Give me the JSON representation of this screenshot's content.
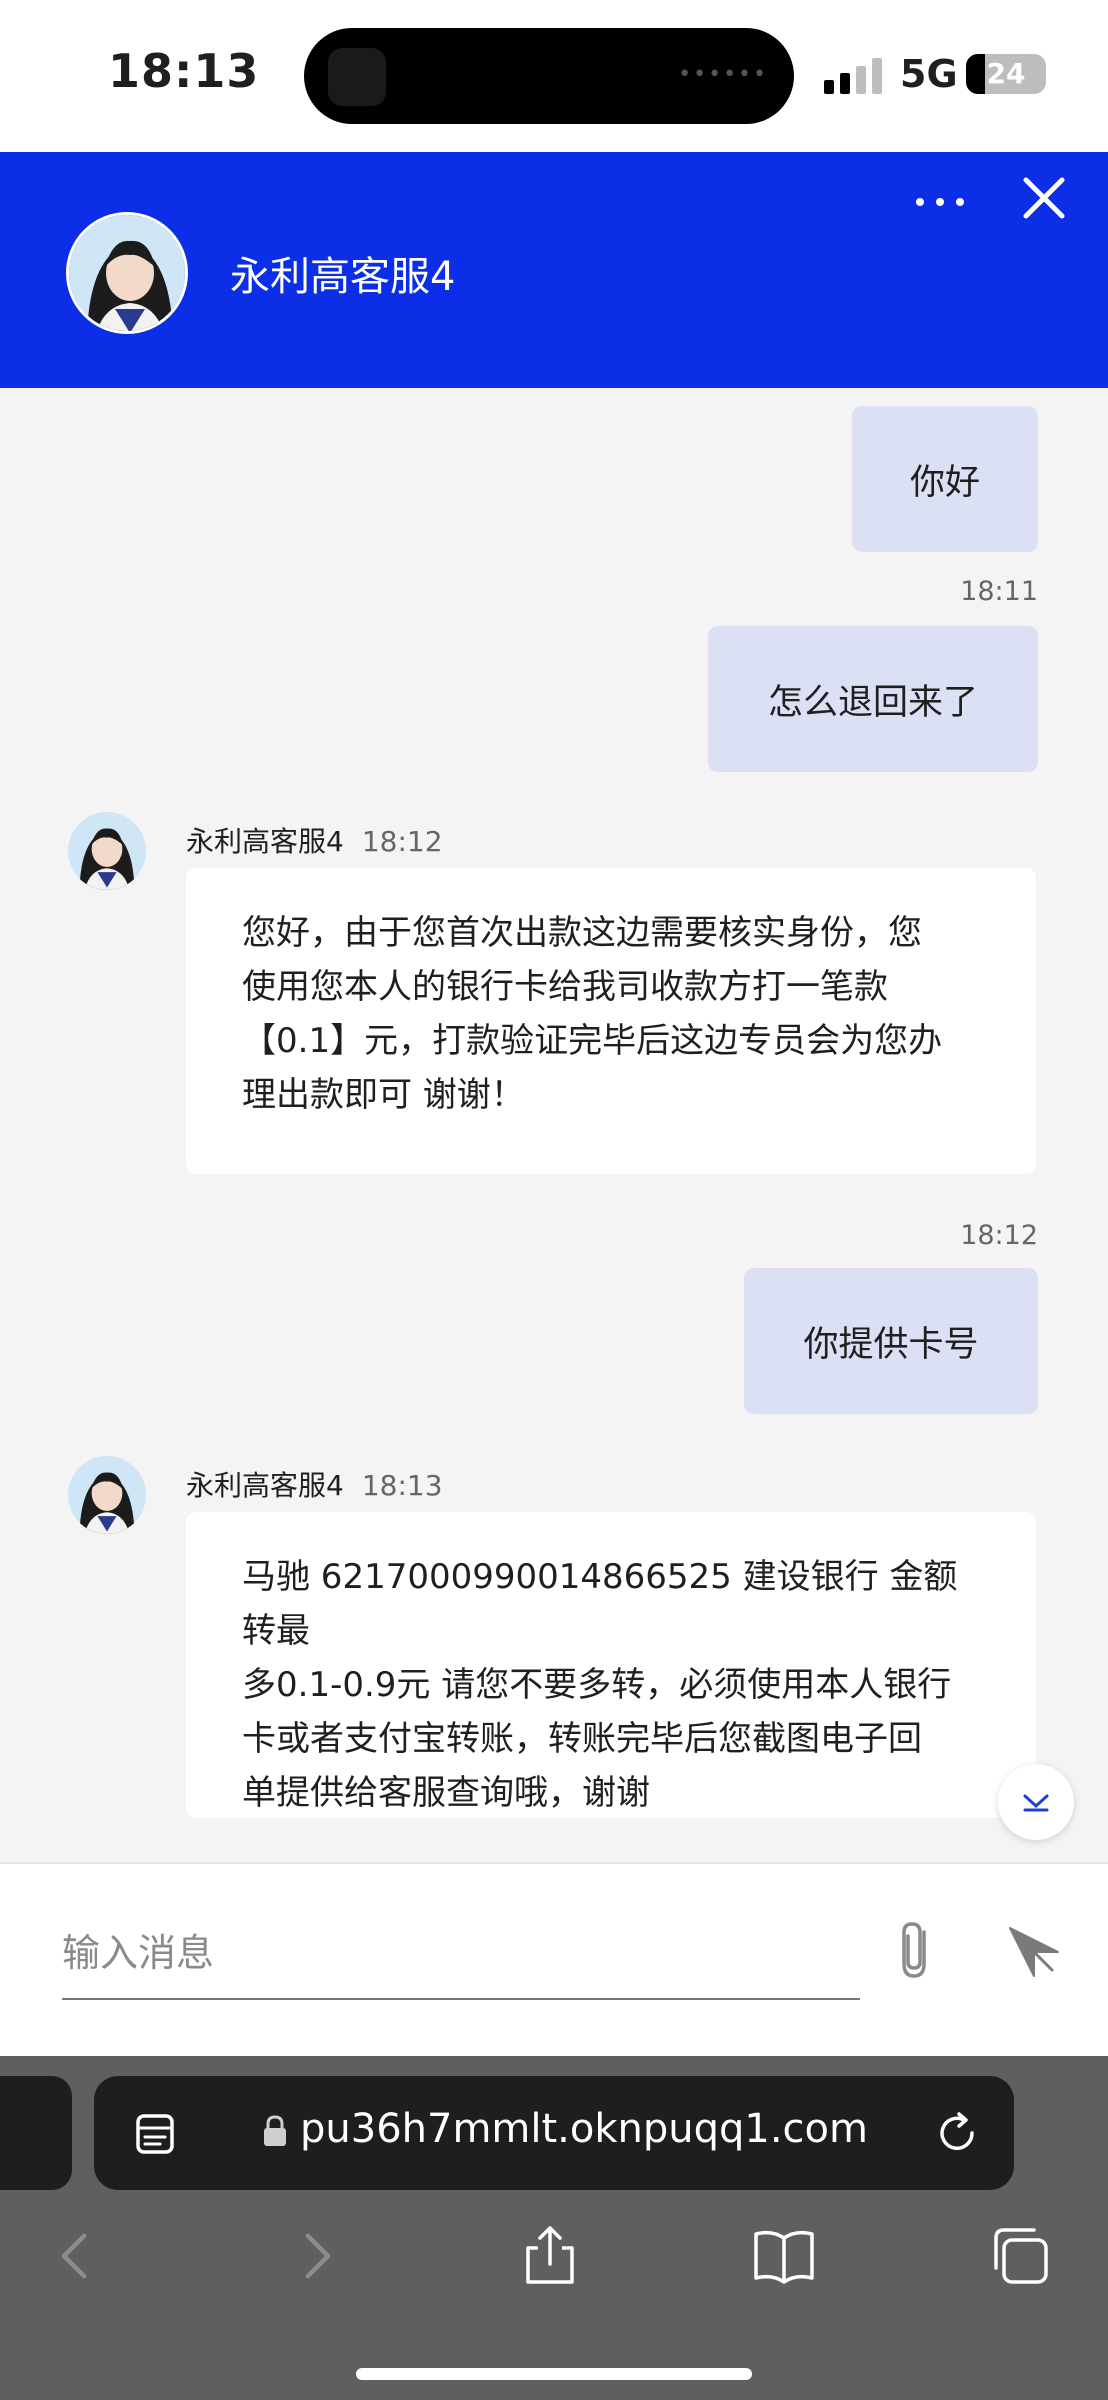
{
  "status_bar": {
    "time": "18:13",
    "network": "5G",
    "battery_level": "24",
    "battery_fraction": 0.24
  },
  "header": {
    "agent_name": "永利高客服4"
  },
  "messages": {
    "out_1": {
      "text": "你好"
    },
    "ts_2": "18:11",
    "out_2": {
      "text": "怎么退回来了"
    },
    "in_1": {
      "sender": "永利高客服4",
      "time": "18:12",
      "lines": [
        "您好，由于您首次出款这边需要核实身份，您",
        "使用您本人的银行卡给我司收款方打一笔款",
        "【0.1】元，打款验证完毕后这边专员会为您办",
        "理出款即可 谢谢！"
      ]
    },
    "ts_3": "18:12",
    "out_3": {
      "text": "你提供卡号"
    },
    "in_2": {
      "sender": "永利高客服4",
      "time": "18:13",
      "lines": [
        "马驰 6217000990014866525 建设银行 金额转最",
        "多0.1-0.9元 请您不要多转，必须使用本人银行",
        "卡或者支付宝转账，转账完毕后您截图电子回",
        "单提供给客服查询哦，谢谢"
      ]
    }
  },
  "composer": {
    "placeholder": "输入消息"
  },
  "browser": {
    "url": "pu36h7mmlt.oknpuqq1.com"
  },
  "colors": {
    "header_bg": "#0b2ee6",
    "outgoing_bubble": "#dbe0f5",
    "incoming_bubble": "#ffffff",
    "chat_bg": "#f4f4f5"
  },
  "icons": [
    "more-icon",
    "close-icon",
    "scroll-down-icon",
    "attach-icon",
    "send-icon",
    "reader-icon",
    "lock-icon",
    "reload-icon",
    "back-icon",
    "forward-icon",
    "share-icon",
    "bookmarks-icon",
    "tabs-icon"
  ]
}
